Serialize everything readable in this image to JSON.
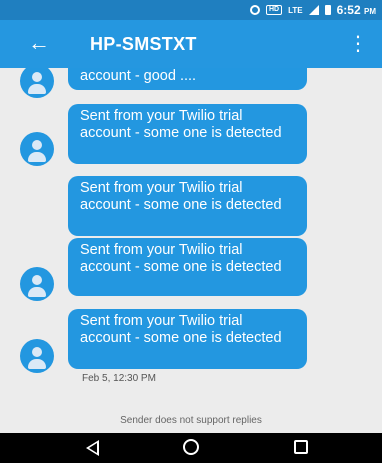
{
  "status_bar": {
    "time": "6:52",
    "time_suffix": "PM",
    "network": "LTE",
    "icons": [
      "data-saver-icon",
      "hd-icon",
      "lte-icon",
      "signal-icon",
      "battery-icon"
    ]
  },
  "app_bar": {
    "back_icon": "←",
    "title": "HP-SMSTXT",
    "menu_icon": "⋮"
  },
  "messages": [
    {
      "text": "account - good ...."
    },
    {
      "text": "Sent from your Twilio trial account - some one is detected"
    },
    {
      "text": "Sent from your Twilio trial account - some one is detected"
    },
    {
      "text": "Sent from your Twilio trial account - some one is detected"
    },
    {
      "text": "Sent from your Twilio trial account - some one is detected"
    }
  ],
  "timestamp": "Feb 5, 12:30 PM",
  "footer_note": "Sender does not support replies",
  "colors": {
    "status_bar": "#1f7fc0",
    "app_bar": "#2597e0",
    "bubble": "#2397e0",
    "background": "#ececec",
    "nav_bar": "#000000"
  }
}
